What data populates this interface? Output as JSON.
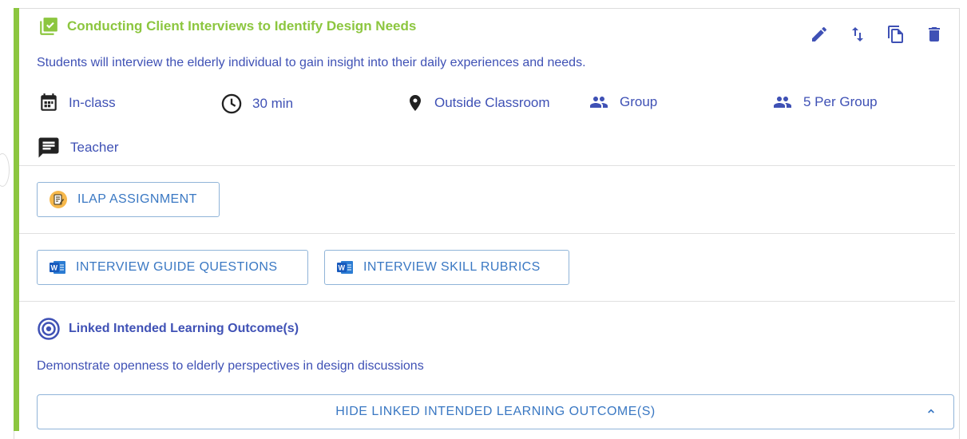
{
  "activity": {
    "title": "Conducting Client Interviews to Identify Design Needs",
    "description": "Students will interview the elderly individual to gain insight into their daily experiences and needs.",
    "meta": {
      "mode": "In-class",
      "duration": "30 min",
      "location": "Outside Classroom",
      "grouping": "Group",
      "group_size": "5 Per Group",
      "facilitator": "Teacher"
    }
  },
  "actions": {
    "edit_icon": "pencil-icon",
    "reorder_icon": "swap-vertical-icon",
    "copy_icon": "copy-icon",
    "delete_icon": "trash-icon"
  },
  "assignment_button": {
    "label": "ILAP ASSIGNMENT"
  },
  "resources": [
    {
      "label": "INTERVIEW GUIDE QUESTIONS",
      "icon": "word-document-icon"
    },
    {
      "label": "INTERVIEW SKILL RUBRICS",
      "icon": "word-document-icon"
    }
  ],
  "ilo": {
    "heading": "Linked Intended Learning Outcome(s)",
    "outcome": "Demonstrate openness to elderly perspectives in design discussions",
    "toggle_label": "HIDE LINKED INTENDED LEARNING OUTCOME(S)"
  },
  "colors": {
    "accent_green": "#8cc63f",
    "text_indigo": "#3f51b5",
    "link_blue": "#3a78c3",
    "border_blue": "#90b4d8"
  }
}
